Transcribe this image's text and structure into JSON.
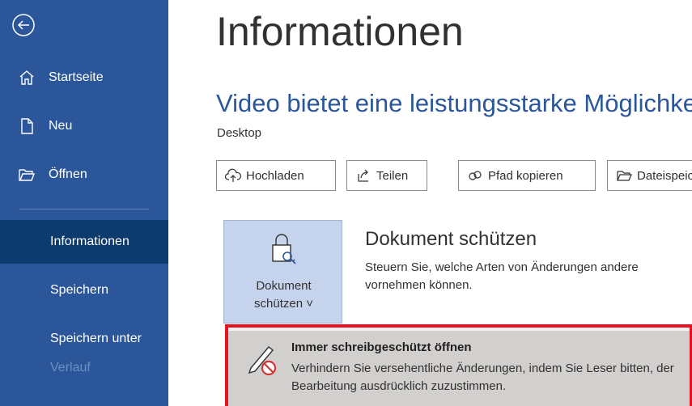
{
  "sidebar": {
    "items": [
      {
        "label": "Startseite",
        "icon": "home-icon"
      },
      {
        "label": "Neu",
        "icon": "new-document-icon"
      },
      {
        "label": "Öffnen",
        "icon": "folder-open-icon"
      },
      {
        "label": "Informationen",
        "active": true
      },
      {
        "label": "Speichern"
      },
      {
        "label": "Speichern unter"
      },
      {
        "label": "Verlauf",
        "disabled": true
      }
    ]
  },
  "main": {
    "title": "Informationen",
    "document_title": "Video bietet eine leistungsstarke Möglichkeit",
    "location": "Desktop",
    "toolbar": [
      {
        "label": "Hochladen",
        "icon": "cloud-upload-icon"
      },
      {
        "label": "Teilen",
        "icon": "share-icon"
      },
      {
        "label": "Pfad kopieren",
        "icon": "link-icon"
      },
      {
        "label": "Dateispeicherort öffnen",
        "icon": "folder-icon"
      }
    ],
    "protect": {
      "tile_line1": "Dokument",
      "tile_line2": "schützen ˅",
      "heading": "Dokument schützen",
      "description": "Steuern Sie, welche Arten von Änderungen andere vornehmen können."
    },
    "dropdown": {
      "title": "Immer schreibgeschützt öffnen",
      "description": "Verhindern Sie versehentliche Änderungen, indem Sie Leser bitten, der Bearbeitung ausdrücklich zuzustimmen."
    }
  },
  "colors": {
    "sidebar": "#2b579a",
    "active": "#0e3b6d",
    "highlight": "#e81123"
  }
}
